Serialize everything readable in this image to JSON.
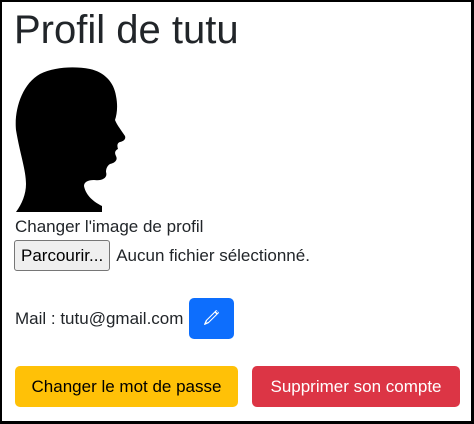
{
  "profile": {
    "title": "Profil de tutu",
    "avatar_icon": "man-silhouette-profile-icon"
  },
  "upload": {
    "label": "Changer l'image de profil",
    "browse_label": "Parcourir...",
    "status_text": "Aucun fichier sélectionné."
  },
  "mail": {
    "text": "Mail : tutu@gmail.com",
    "edit_icon": "pencil-icon"
  },
  "actions": {
    "change_password_label": "Changer le mot de passe",
    "delete_account_label": "Supprimer son compte"
  },
  "colors": {
    "primary": "#0d6efd",
    "warning": "#ffc107",
    "danger": "#dc3545",
    "text": "#212529"
  }
}
